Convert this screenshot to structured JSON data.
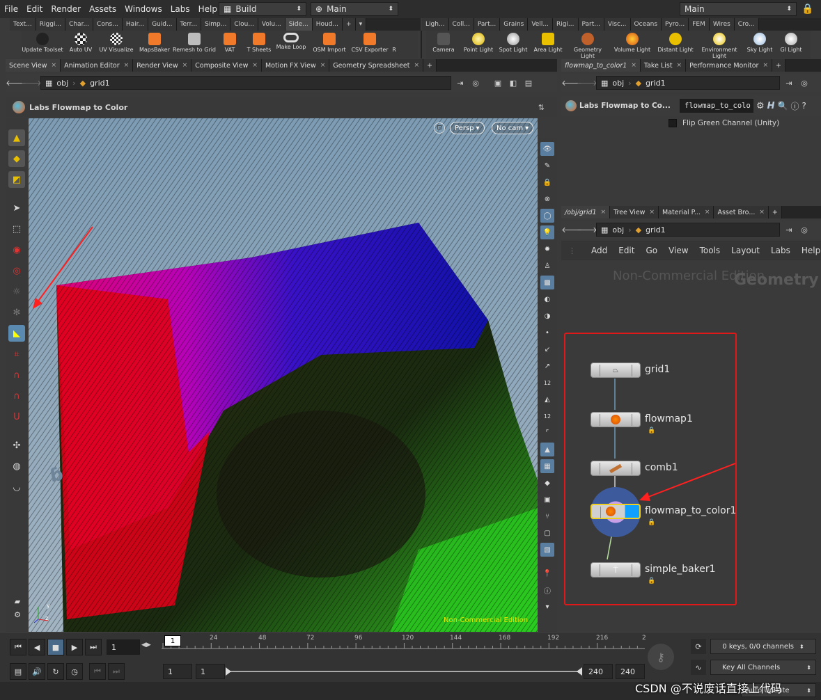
{
  "menu": [
    "File",
    "Edit",
    "Render",
    "Assets",
    "Windows",
    "Labs",
    "Help"
  ],
  "desktop_combo": "Build",
  "main_combo": "Main",
  "right_combo": "Main",
  "shelf_tabs_left": [
    "Text...",
    "Riggi...",
    "Char...",
    "Cons...",
    "Hair...",
    "Guid...",
    "Terr...",
    "Simp...",
    "Clou...",
    "Volu...",
    "Side...",
    "Houd..."
  ],
  "shelf_tabs_right": [
    "Ligh...",
    "Coll...",
    "Part...",
    "Grains",
    "Vell...",
    "Rigi...",
    "Part...",
    "Visc...",
    "Oceans",
    "Pyro...",
    "FEM",
    "Wires",
    "Cro..."
  ],
  "shelf_tools_left": [
    "Update Toolset",
    "Auto UV",
    "UV Visualize",
    "MapsBaker",
    "Remesh to Grid",
    "VAT",
    "T Sheets",
    "Make Loop",
    "OSM Import",
    "CSV Exporter",
    "R"
  ],
  "shelf_tools_right": [
    "Camera",
    "Point Light",
    "Spot Light",
    "Area Light",
    "Geometry Light",
    "Volume Light",
    "Distant Light",
    "Environment Light",
    "Sky Light",
    "GI Light"
  ],
  "pane_tabs_left": [
    "Scene View",
    "Animation Editor",
    "Render View",
    "Composite View",
    "Motion FX View",
    "Geometry Spreadsheet"
  ],
  "pane_tabs_param": [
    "flowmap_to_color1",
    "Take List",
    "Performance Monitor"
  ],
  "pane_tabs_net": [
    "/obj/grid1",
    "Tree View",
    "Material P...",
    "Asset Bro..."
  ],
  "path": {
    "obj": "obj",
    "node": "grid1"
  },
  "viewport": {
    "tool_title": "Labs Flowmap to Color",
    "persp": "Persp",
    "cam": "No cam",
    "watermark": "Non-Commercial Edition",
    "axis_y": "y",
    "axis_z": "z"
  },
  "params": {
    "title": "Labs Flowmap to Co...",
    "node_name": "flowmap_to_colo",
    "checkbox_label": "Flip Green Channel (Unity)",
    "h_label": "H"
  },
  "network": {
    "menu": [
      "Add",
      "Edit",
      "Go",
      "View",
      "Tools",
      "Layout",
      "Labs",
      "Help"
    ],
    "watermark": "Non-Commercial Edition",
    "context": "Geometry",
    "nodes": [
      "grid1",
      "flowmap1",
      "comb1",
      "flowmap_to_color1",
      "simple_baker1"
    ]
  },
  "timeline": {
    "frame": "1",
    "marker": "1",
    "ticks": [
      "24",
      "48",
      "72",
      "96",
      "120",
      "144",
      "168",
      "192",
      "216",
      "2"
    ],
    "start": "1",
    "start2": "1",
    "end": "240",
    "end2": "240",
    "keys": "0 keys, 0/0 channels",
    "key_all": "Key All Channels",
    "auto_update": "Auto Update"
  },
  "overlay_watermark": "CSDN @不说废话直接上代码"
}
